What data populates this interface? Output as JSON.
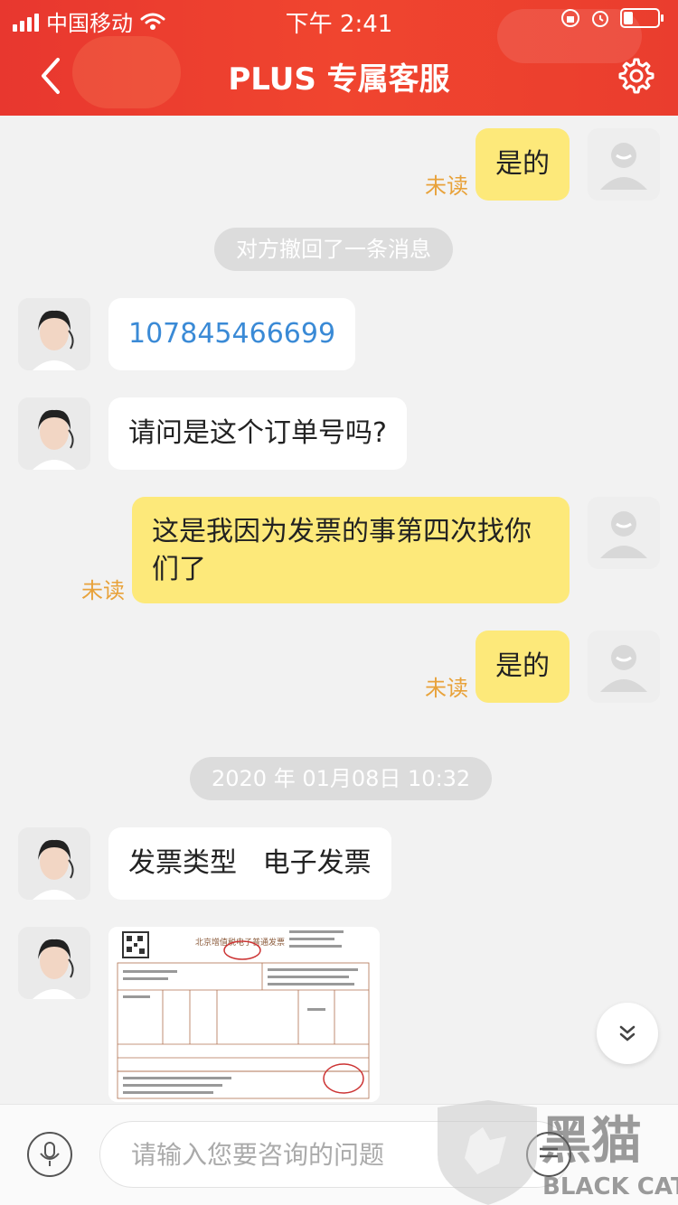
{
  "status_bar": {
    "carrier": "中国移动",
    "time": "下午 2:41"
  },
  "header": {
    "title": "PLUS 专属客服"
  },
  "messages": {
    "m1": {
      "text": "是的",
      "status": "未读"
    },
    "recall_notice": "对方撤回了一条消息",
    "m2": {
      "text": "107845466699"
    },
    "m3": {
      "text": "请问是这个订单号吗?"
    },
    "m4": {
      "text": "这是我因为发票的事第四次找你们了",
      "status": "未读"
    },
    "m5": {
      "text": "是的",
      "status": "未读"
    },
    "timestamp": "2020 年 01月08日 10:32",
    "m6": {
      "text": "发票类型   电子发票"
    },
    "m7": {
      "invoice_title": "北京增值税电子普通发票"
    }
  },
  "input": {
    "placeholder": "请输入您要咨询的问题"
  },
  "watermark": {
    "brand_cn": "黑猫",
    "brand_en": "BLACK CAT"
  },
  "colors": {
    "header_red": "#e8372f",
    "user_bubble": "#fde97a",
    "unread": "#e8a23a",
    "link": "#3a8ad6"
  }
}
